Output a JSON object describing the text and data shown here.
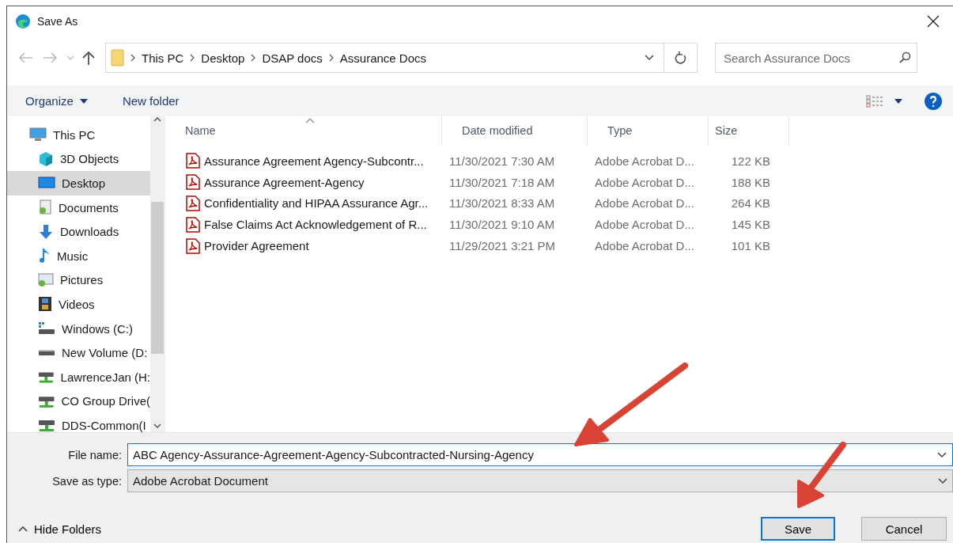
{
  "window": {
    "title": "Save As"
  },
  "address": {
    "crumbs": [
      "This PC",
      "Desktop",
      "DSAP docs",
      "Assurance Docs"
    ]
  },
  "search": {
    "placeholder": "Search Assurance Docs"
  },
  "toolbar": {
    "organize": "Organize",
    "new_folder": "New folder"
  },
  "sidebar": {
    "items": [
      {
        "label": "This PC",
        "selected": false,
        "children": [
          {
            "label": "3D Objects",
            "selected": false
          },
          {
            "label": "Desktop",
            "selected": true
          },
          {
            "label": "Documents",
            "selected": false
          },
          {
            "label": "Downloads",
            "selected": false
          },
          {
            "label": "Music",
            "selected": false
          },
          {
            "label": "Pictures",
            "selected": false
          },
          {
            "label": "Videos",
            "selected": false
          },
          {
            "label": "Windows (C:)",
            "selected": false
          },
          {
            "label": "New Volume (D:",
            "selected": false
          },
          {
            "label": "LawrenceJan (H:",
            "selected": false
          },
          {
            "label": "CO Group Drive(",
            "selected": false
          },
          {
            "label": "DDS-Common(I",
            "selected": false
          }
        ]
      }
    ]
  },
  "table": {
    "columns": [
      "Name",
      "Date modified",
      "Type",
      "Size"
    ],
    "rows": [
      {
        "name": "Assurance Agreement Agency-Subcontr...",
        "date": "11/30/2021 7:30 AM",
        "type": "Adobe Acrobat D...",
        "size": "122 KB"
      },
      {
        "name": "Assurance Agreement-Agency",
        "date": "11/30/2021 7:18 AM",
        "type": "Adobe Acrobat D...",
        "size": "188 KB"
      },
      {
        "name": "Confidentiality and HIPAA Assurance Agr...",
        "date": "11/30/2021 8:33 AM",
        "type": "Adobe Acrobat D...",
        "size": "264 KB"
      },
      {
        "name": "False Claims Act Acknowledgement of R...",
        "date": "11/30/2021 9:10 AM",
        "type": "Adobe Acrobat D...",
        "size": "145 KB"
      },
      {
        "name": "Provider Agreement",
        "date": "11/29/2021 3:21 PM",
        "type": "Adobe Acrobat D...",
        "size": "101 KB"
      }
    ]
  },
  "form": {
    "file_name_label": "File name:",
    "file_name": "ABC Agency-Assurance-Agreement-Agency-Subcontracted-Nursing-Agency",
    "type_label": "Save as type:",
    "type_value": "Adobe Acrobat Document"
  },
  "footer": {
    "hide_folders": "Hide Folders",
    "buttons": [
      "Save",
      "Cancel"
    ]
  }
}
